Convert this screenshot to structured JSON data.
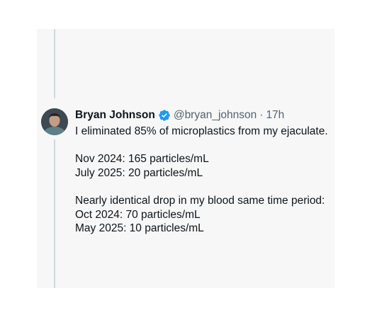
{
  "tweet": {
    "author_name": "Bryan Johnson",
    "handle": "@bryan_johnson",
    "separator": "·",
    "time": "17h",
    "verified_icon": "verified-badge-icon",
    "avatar": "avatar",
    "lines": [
      "I eliminated 85% of microplastics from my ejaculate.",
      "",
      "Nov 2024: 165 particles/mL",
      "July 2025: 20 particles/mL",
      "",
      "Nearly identical drop in my blood same time period:",
      "Oct 2024: 70 particles/mL",
      "May 2025: 10 particles/mL"
    ]
  },
  "colors": {
    "card_background": "#f7f7f7",
    "thread_line": "#cfd9de",
    "verified_blue": "#1d9bf0",
    "secondary_text": "#536471",
    "primary_text": "#0f1419"
  }
}
